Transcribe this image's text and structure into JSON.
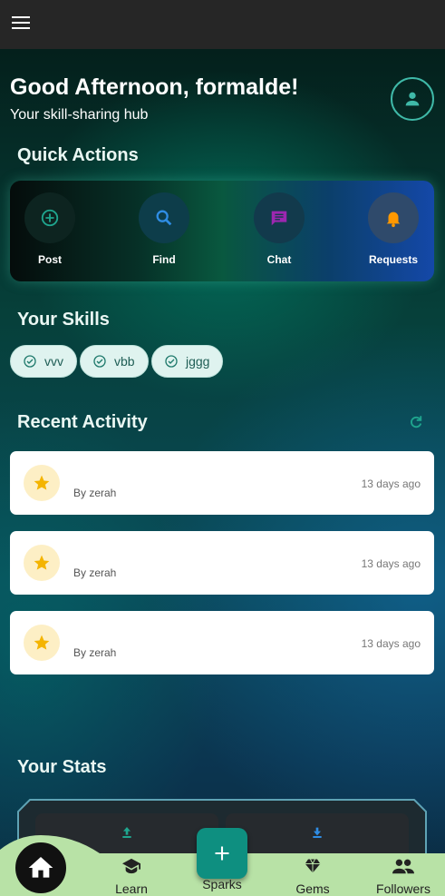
{
  "header": {
    "menu_icon": "menu-icon"
  },
  "greeting": {
    "title": "Good Afternoon, formalde!",
    "subtitle": "Your skill-sharing hub",
    "profile_icon": "person-icon"
  },
  "quick_actions": {
    "title": "Quick Actions",
    "items": [
      {
        "label": "Post",
        "icon": "add-circle-icon",
        "color": "#1fa58e"
      },
      {
        "label": "Find",
        "icon": "search-icon",
        "color": "#2f8de4"
      },
      {
        "label": "Chat",
        "icon": "chat-icon",
        "color": "#9c27b0"
      },
      {
        "label": "Requests",
        "icon": "bell-icon",
        "color": "#ff9800"
      }
    ]
  },
  "skills": {
    "title": "Your Skills",
    "items": [
      "vvv",
      "vbb",
      "jggg"
    ]
  },
  "recent_activity": {
    "title": "Recent Activity",
    "items": [
      {
        "by": "By zerah",
        "time": "13 days ago"
      },
      {
        "by": "By zerah",
        "time": "13 days ago"
      },
      {
        "by": "By zerah",
        "time": "13 days ago"
      }
    ]
  },
  "stats": {
    "title": "Your Stats"
  },
  "bottom_nav": {
    "items": [
      {
        "label": "Learn",
        "icon": "school-icon"
      },
      {
        "label": "Sparks",
        "icon": "add-icon"
      },
      {
        "label": "Gems",
        "icon": "diamond-icon"
      },
      {
        "label": "Followers",
        "icon": "people-icon"
      }
    ],
    "home_icon": "home-icon"
  },
  "colors": {
    "accent": "#0e8f80",
    "nav_bg": "#b8e2a6",
    "appbar": "#262626"
  }
}
